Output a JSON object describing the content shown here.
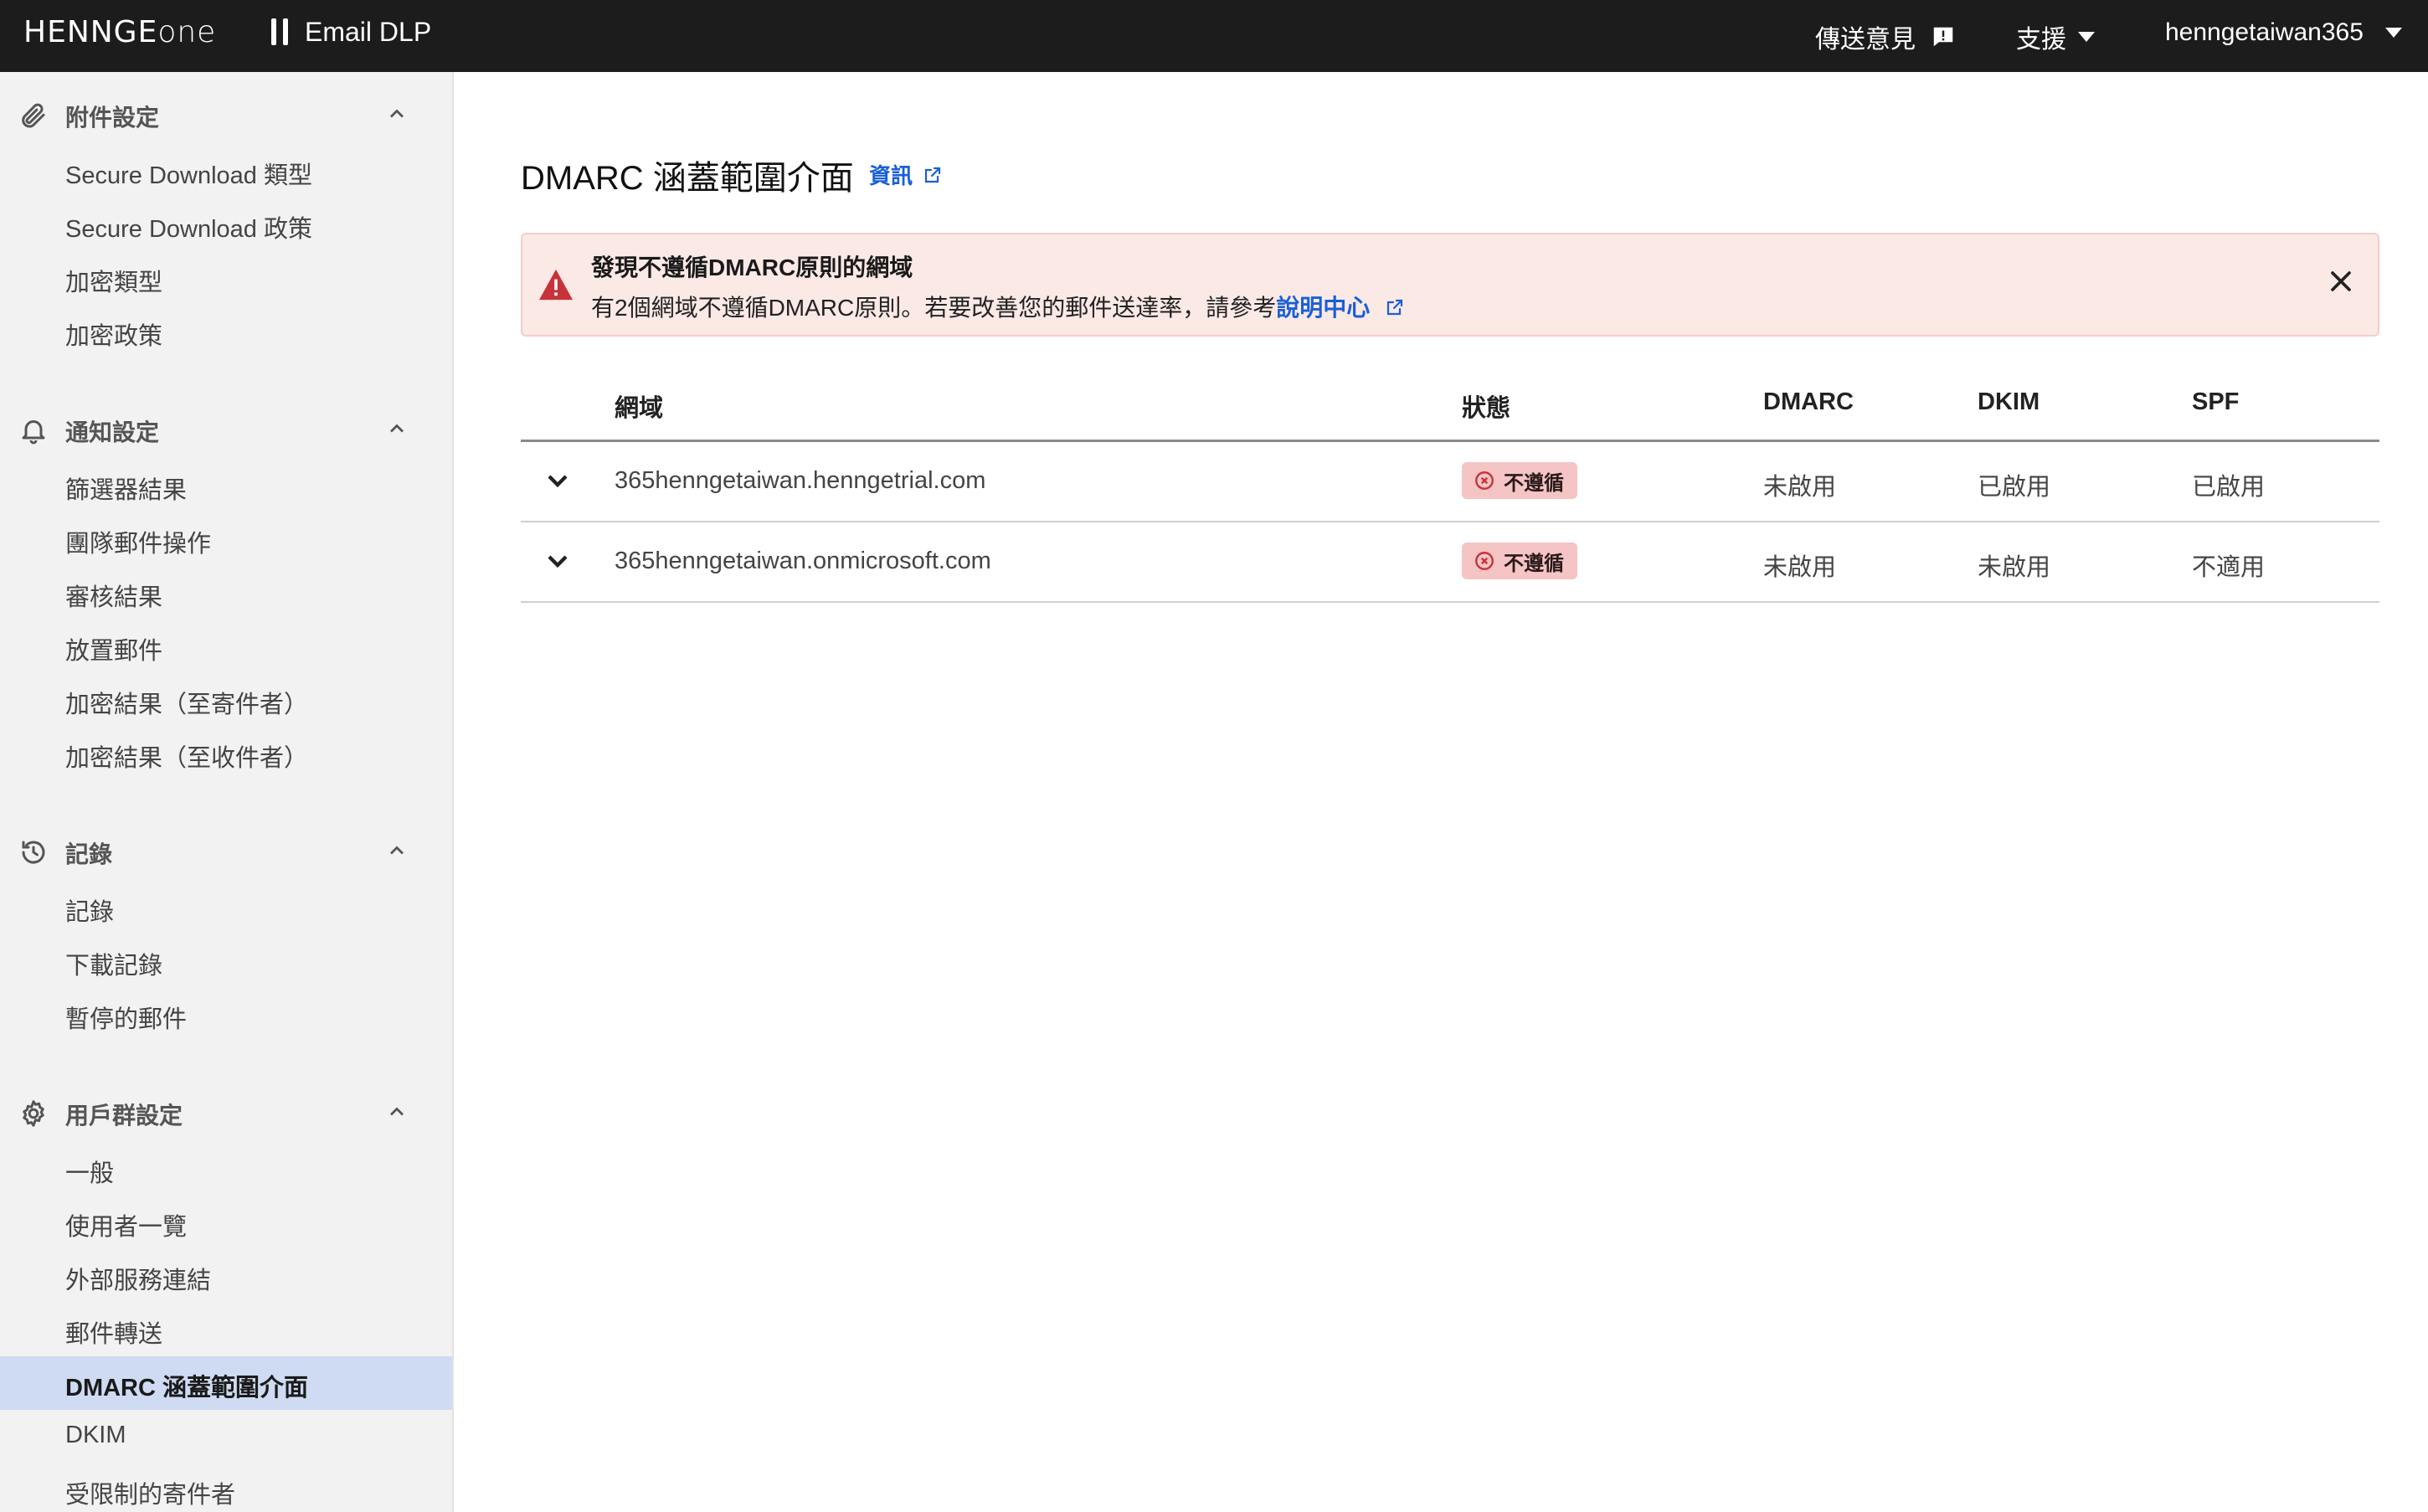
{
  "topbar": {
    "logo_main": "HENNGE",
    "logo_sub": "one",
    "product": "Email DLP",
    "feedback": "傳送意見",
    "support": "支援",
    "user": "henngetaiwan365"
  },
  "sidebar": {
    "sections": [
      {
        "title": "附件設定",
        "icon": "paperclip-icon",
        "items": [
          "Secure Download 類型",
          "Secure Download 政策",
          "加密類型",
          "加密政策"
        ]
      },
      {
        "title": "通知設定",
        "icon": "bell-icon",
        "items": [
          "篩選器結果",
          "團隊郵件操作",
          "審核結果",
          "放置郵件",
          "加密結果（至寄件者）",
          "加密結果（至收件者）"
        ]
      },
      {
        "title": "記錄",
        "icon": "history-icon",
        "items": [
          "記錄",
          "下載記錄",
          "暫停的郵件"
        ]
      },
      {
        "title": "用戶群設定",
        "icon": "gear-icon",
        "items": [
          "一般",
          "使用者一覽",
          "外部服務連結",
          "郵件轉送",
          "DMARC 涵蓋範圍介面",
          "DKIM",
          "受限制的寄件者"
        ]
      }
    ],
    "active_item": "DMARC 涵蓋範圍介面"
  },
  "main": {
    "title": "DMARC 涵蓋範圍介面",
    "info_link": "資訊",
    "alert": {
      "title": "發現不遵循DMARC原則的網域",
      "body": "有2個網域不遵循DMARC原則。若要改善您的郵件送達率，請參考",
      "link": "說明中心"
    },
    "table": {
      "headers": {
        "domain": "網域",
        "status": "狀態",
        "dmarc": "DMARC",
        "dkim": "DKIM",
        "spf": "SPF"
      },
      "rows": [
        {
          "domain": "365henngetaiwan.henngetrial.com",
          "status": "不遵循",
          "dmarc": "未啟用",
          "dkim": "已啟用",
          "spf": "已啟用"
        },
        {
          "domain": "365henngetaiwan.onmicrosoft.com",
          "status": "不遵循",
          "dmarc": "未啟用",
          "dkim": "未啟用",
          "spf": "不適用"
        }
      ]
    }
  },
  "colors": {
    "topbar_bg": "#1c1c1c",
    "sidebar_bg": "#f2f2f2",
    "active_bg": "#cfdbf3",
    "link": "#1a5fd6",
    "alert_bg": "#fbe9e6",
    "warn": "#c8323a",
    "badge_bg": "#f5c4c4"
  }
}
